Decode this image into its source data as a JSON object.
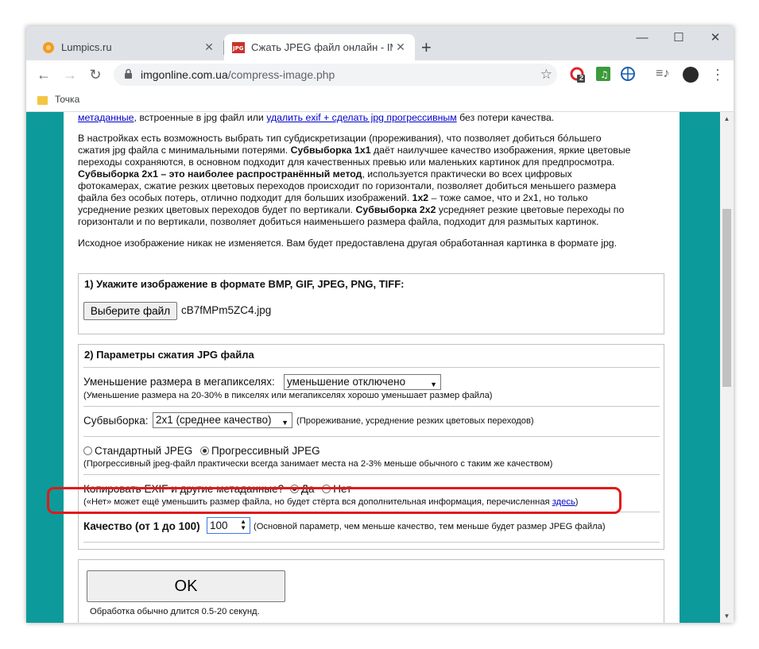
{
  "browser": {
    "tabs": [
      {
        "title": "Lumpics.ru",
        "active": false
      },
      {
        "title": "Сжать JPEG файл онлайн - IMG",
        "active": true
      }
    ],
    "url_host": "imgonline.com.ua",
    "url_path": "/compress-image.php",
    "bookmark": "Точка",
    "ext_badge": "2"
  },
  "intro": {
    "line0_link1": "метаданные",
    "line0_text1": ", встроенные в jpg файл или ",
    "line0_link2": "удалить exif + сделать jpg прогрессивным",
    "line0_text2": " без потери качества.",
    "p2_lines": [
      "В настройках есть возможность выбрать тип субдискретизации (прореживания), что позволяет добиться бóльшего",
      "сжатия jpg файла с минимальными потерями.",
      "переходы сохраняются, в основном подходит для качественных превью или маленьких картинок для предпросмотра.",
      "фотокамерах, сжатие резких цветовых переходов происходит по горизонтали, позволяет добиться меньшего размера",
      "файла без особых потерь, отлично подходит для больших изображений.",
      "усреднение резких цветовых переходов будет по вертикали.",
      "горизонтали и по вертикали, позволяет добиться наименьшего размера файла, подходит для размытых картинок."
    ],
    "b_1x1": "Субвыборка 1х1",
    "t_1x1": " даёт наилучшее качество изображения, яркие цветовые",
    "b_2x1": "Субвыборка 2х1 – это наиболее распространённый метод",
    "t_2x1": ", используется практически во всех цифровых",
    "b_1x2": "1х2",
    "t_1x2": " – тоже самое, что и 2х1, но только",
    "b_2x2": "Субвыборка 2х2",
    "t_2x2": " усредняет резкие цветовые переходы по",
    "p3": "Исходное изображение никак не изменяется. Вам будет предоставлена другая обработанная картинка в формате jpg."
  },
  "step1": {
    "legend": "1) Укажите изображение в формате BMP, GIF, JPEG, PNG, TIFF:",
    "button": "Выберите файл",
    "filename": "cB7fMPm5ZC4.jpg"
  },
  "step2": {
    "legend": "2) Параметры сжатия JPG файла",
    "resize_label": "Уменьшение размера в мегапикселях:",
    "resize_value": "уменьшение отключено",
    "resize_note": "(Уменьшение размера на 20-30% в пикселях или мегапикселях хорошо уменьшает размер файла)",
    "subsample_label": "Субвыборка:",
    "subsample_value": "2x1 (среднее качество)",
    "subsample_note": "(Прореживание, усреднение резких цветовых переходов)",
    "jpeg_standard": "Стандартный JPEG",
    "jpeg_progressive": "Прогрессивный JPEG",
    "jpeg_note": "(Прогрессивный jpeg-файл практически всегда занимает места на 2-3% меньше обычного с таким же качеством)",
    "exif_label": "Копировать EXIF и другие метаданные?",
    "exif_yes": "Да",
    "exif_no": "Нет",
    "exif_note": "(«Нет» может ещё уменьшить размер файла, но будет стёрта вся дополнительная информация, перечисленная ",
    "exif_link": "здесь",
    "exif_note_end": ")",
    "quality_label": "Качество (от 1 до 100)",
    "quality_value": "100",
    "quality_note": "(Основной параметр, чем меньше качество, тем меньше будет размер JPEG файла)"
  },
  "submit": {
    "button": "OK",
    "note": "Обработка обычно длится 0.5-20 секунд."
  },
  "colors": {
    "page_bg": "#0d9a9a",
    "highlight": "#e11919",
    "link": "#0000cc"
  }
}
